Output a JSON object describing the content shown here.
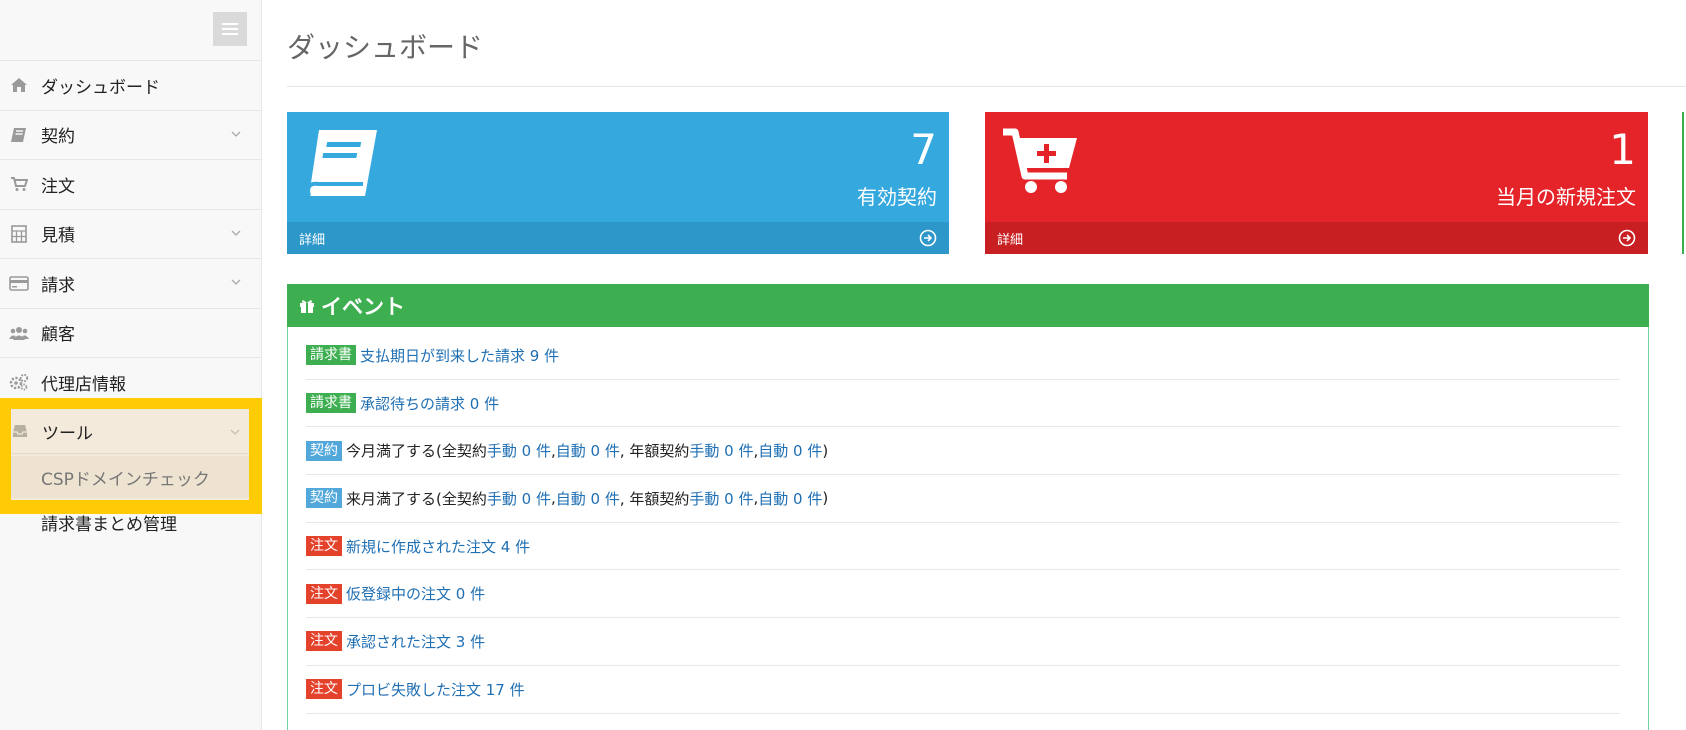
{
  "page": {
    "title": "ダッシュボード"
  },
  "sidebar": {
    "items": [
      {
        "label": "ダッシュボード",
        "icon": "home-icon"
      },
      {
        "label": "契約",
        "icon": "book-icon"
      },
      {
        "label": "注文",
        "icon": "cart-icon"
      },
      {
        "label": "見積",
        "icon": "calculator-icon"
      },
      {
        "label": "請求",
        "icon": "credit-card-icon"
      },
      {
        "label": "顧客",
        "icon": "users-icon"
      },
      {
        "label": "代理店情報",
        "icon": "gears-icon"
      }
    ],
    "tools": {
      "label": "ツール",
      "icon": "inbox-icon",
      "sub_items": [
        "CSPドメインチェック",
        "請求書まとめ管理"
      ]
    }
  },
  "panels": [
    {
      "count": "7",
      "label": "有効契約",
      "footer": "詳細",
      "color": "#35a8de",
      "icon": "book-icon"
    },
    {
      "count": "1",
      "label": "当月の新規注文",
      "footer": "詳細",
      "color": "#e42428",
      "icon": "cart-plus-icon"
    }
  ],
  "events": {
    "title": "イベント",
    "rows": [
      {
        "badge": "請求書",
        "text": "支払期日が到来した請求 9 件"
      },
      {
        "badge": "請求書",
        "text": "承認待ちの請求 0 件"
      },
      {
        "badge": "契約",
        "prefix": "今月満了する(全契約 ",
        "l1": "手動 0 件",
        "sep1": ", ",
        "l2": "自動 0 件",
        "mid": ", 年額契約 ",
        "l3": "手動 0 件",
        "sep2": ", ",
        "l4": "自動 0 件",
        "suffix": ")"
      },
      {
        "badge": "契約",
        "prefix": "来月満了する(全契約 ",
        "l1": "手動 0 件",
        "sep1": ", ",
        "l2": "自動 0 件",
        "mid": ", 年額契約 ",
        "l3": "手動 0 件",
        "sep2": ", ",
        "l4": "自動 0 件",
        "suffix": ")"
      },
      {
        "badge": "注文",
        "text": "新規に作成された注文 4 件"
      },
      {
        "badge": "注文",
        "text": "仮登録中の注文 0 件"
      },
      {
        "badge": "注文",
        "text": "承認された注文 3 件"
      },
      {
        "badge": "注文",
        "text": "プロビ失敗した注文 17 件"
      }
    ]
  },
  "colors": {
    "highlight": "#ffcb05",
    "event_header": "#3daf50",
    "link": "#1f6fb3"
  }
}
